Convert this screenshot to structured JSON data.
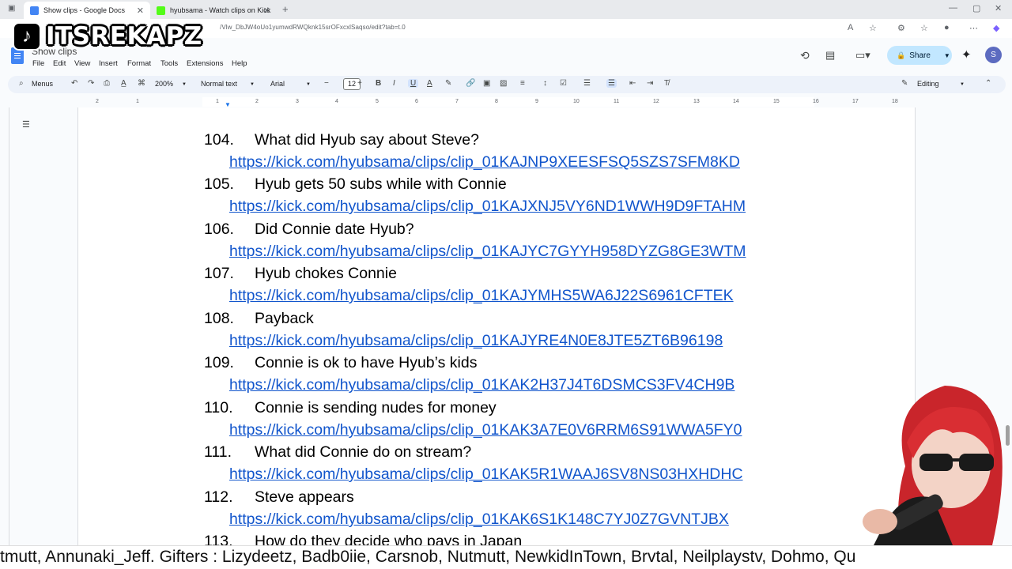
{
  "browser": {
    "tabs": [
      {
        "title": "Show clips - Google Docs",
        "active": true,
        "favicon_color": "#4285f4"
      },
      {
        "title": "hyubsama - Watch clips on Kick",
        "active": false,
        "favicon_color": "#53fc18"
      }
    ],
    "url": "/Vlw_DbJW4oUo1yumwdRWQknk15srOFxcxlSaqso/edit?tab=t.0"
  },
  "docs": {
    "title": "Show clips",
    "menu": [
      "File",
      "Edit",
      "View",
      "Insert",
      "Format",
      "Tools",
      "Extensions",
      "Help"
    ],
    "share_label": "Share",
    "avatar_letter": "S",
    "toolbar": {
      "search_label": "Menus",
      "zoom": "200%",
      "style": "Normal text",
      "font": "Arial",
      "font_size": "12",
      "mode": "Editing"
    },
    "ruler_numbers": [
      "2",
      "1",
      "1",
      "2",
      "3",
      "4",
      "5",
      "6",
      "7",
      "8",
      "9",
      "10",
      "11",
      "12",
      "13",
      "14",
      "15",
      "16",
      "17",
      "18"
    ]
  },
  "entries": [
    {
      "num": "104.",
      "title": "What did Hyub say about Steve?",
      "link": "https://kick.com/hyubsama/clips/clip_01KAJNP9XEESFSQ5SZS7SFM8KD"
    },
    {
      "num": "105.",
      "title": "Hyub gets 50 subs while with Connie",
      "link": "https://kick.com/hyubsama/clips/clip_01KAJXNJ5VY6ND1WWH9D9FTAHM"
    },
    {
      "num": "106.",
      "title": "Did Connie date Hyub?",
      "link": "https://kick.com/hyubsama/clips/clip_01KAJYC7GYYH958DYZG8GE3WTM"
    },
    {
      "num": "107.",
      "title": "Hyub chokes Connie",
      "link": "https://kick.com/hyubsama/clips/clip_01KAJYMHS5WA6J22S6961CFTEK"
    },
    {
      "num": "108.",
      "title": "Payback",
      "link": "https://kick.com/hyubsama/clips/clip_01KAJYRE4N0E8JTE5ZT6B96198"
    },
    {
      "num": "109.",
      "title": "Connie is ok to have Hyub’s kids",
      "link": "https://kick.com/hyubsama/clips/clip_01KAK2H37J4T6DSMCS3FV4CH9B"
    },
    {
      "num": "110.",
      "title": "Connie is sending nudes for money",
      "link": "https://kick.com/hyubsama/clips/clip_01KAK3A7E0V6RRM6S91WWA5FY0"
    },
    {
      "num": "111.",
      "title": "What did Connie do on stream?",
      "link": "https://kick.com/hyubsama/clips/clip_01KAK5R1WAAJ6SV8NS03HXHDHC"
    },
    {
      "num": "112.",
      "title": "Steve appears",
      "link": "https://kick.com/hyubsama/clips/clip_01KAK6S1K148C7YJ0Z7GVNTJBX"
    },
    {
      "num": "113.",
      "title": "How do they decide who pays in Japan"
    }
  ],
  "overlay": {
    "watermark": "ITSREKAPZ",
    "ticker": "tmutt, Annunaki_Jeff. Gifters : Lizydeetz, Badb0iie, Carsnob, Nutmutt, NewkidInTown, Brvtal, Neilplaystv, Dohmo, Qu"
  }
}
